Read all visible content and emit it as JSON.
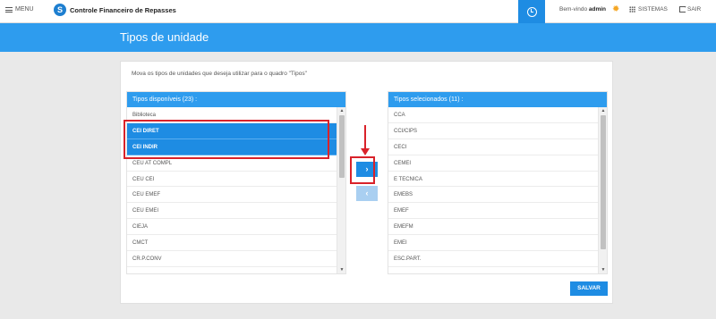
{
  "topbar": {
    "menu_label": "MENU",
    "logo_letter": "S",
    "app_title": "Controle Financeiro de Repasses",
    "welcome_prefix": "Bem-vindo",
    "user_name": "admin",
    "systems_label": "SISTEMAS",
    "exit_label": "SAIR"
  },
  "page": {
    "title": "Tipos de unidade",
    "instruction": "Mova os tipos de unidades que deseja utilizar para o quadro \"Tipos\"",
    "save_label": "SALVAR",
    "add_icon": "›",
    "remove_icon": "‹"
  },
  "available": {
    "title": "Tipos disponíveis (23) :",
    "items": [
      "Biblioteca",
      "CEI DIRET",
      "CEI INDIR",
      "CEU AT COMPL",
      "CEU CEI",
      "CEU EMEF",
      "CEU EMEI",
      "CIEJA",
      "CMCT",
      "CR.P.CONV"
    ],
    "selected": [
      "CEI DIRET",
      "CEI INDIR"
    ]
  },
  "chosen": {
    "title": "Tipos selecionados (11) :",
    "items": [
      "CCA",
      "CCI/CIPS",
      "CECI",
      "CEMEI",
      "E TECNICA",
      "EMEBS",
      "EMEF",
      "EMEFM",
      "EMEI",
      "ESC.PART."
    ]
  },
  "colors": {
    "accent": "#1e8ce3",
    "header": "#2e9cee",
    "annotation": "#d9222a"
  }
}
